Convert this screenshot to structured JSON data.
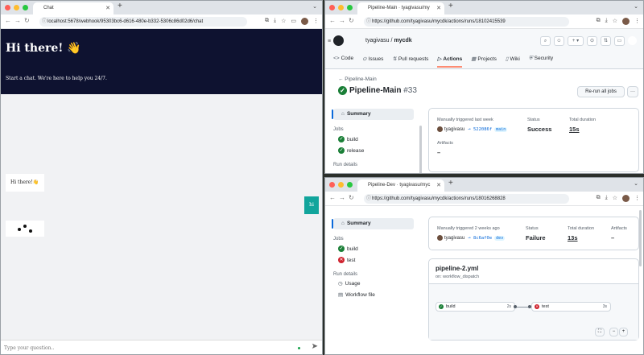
{
  "left_window": {
    "tab_title": "Chat",
    "url": "localhost:5678/webhook/95303bc6-d616-480e-b332-5306c86d02d6/chat",
    "hero_title": "Hi there! 👋",
    "hero_subtitle": "Start a chat. We're here to help you 24/7.",
    "bot_message": "Hi there!👋",
    "user_message": "hi",
    "input_placeholder": "Type your question..",
    "send_icon": "➤"
  },
  "top_right": {
    "tab_title": "Pipeline-Main · tyagivasu/my",
    "url": "https://github.com/tyagivasu/mycdk/actions/runs/18102415539",
    "owner": "tyagivasu",
    "separator": "/",
    "repo": "mycdk",
    "nav": [
      "Code",
      "Issues",
      "Pull requests",
      "Actions",
      "Projects",
      "Wiki",
      "Security"
    ],
    "nav_icons": [
      "<>",
      "⊙",
      "⇅",
      "▷",
      "▦",
      "▯",
      "⛨"
    ],
    "breadcrumb": "← Pipeline-Main",
    "run_name": "Pipeline-Main",
    "run_number": "#33",
    "rerun_label": "Re-run all jobs",
    "more_label": "···",
    "sidebar": {
      "summary": "Summary",
      "jobs_label": "Jobs",
      "jobs": [
        "build",
        "release"
      ],
      "run_details": "Run details"
    },
    "trigger": "Manually triggered last week",
    "actor": "tyagivasu",
    "commit": "522086f",
    "branch": "main",
    "status_label": "Status",
    "status_value": "Success",
    "duration_label": "Total duration",
    "duration_value": "15s",
    "artifacts_label": "Artifacts",
    "artifacts_value": "–"
  },
  "bottom_right": {
    "tab_title": "Pipeline-Dev · tyagivasu/myc",
    "url": "https://github.com/tyagivasu/mycdk/actions/runs/18016268828",
    "sidebar": {
      "summary": "Summary",
      "jobs_label": "Jobs",
      "jobs": [
        "build",
        "test"
      ],
      "run_details": "Run details",
      "details": [
        "Usage",
        "Workflow file"
      ]
    },
    "trigger": "Manually triggered 2 weeks ago",
    "actor": "tyagivasu",
    "commit": "8c6af0e",
    "branch": "dev",
    "status_label": "Status",
    "status_value": "Failure",
    "duration_label": "Total duration",
    "duration_value": "13s",
    "artifacts_label": "Artifacts",
    "artifacts_value": "–",
    "workflow_file": "pipeline-2.yml",
    "workflow_trigger": "on: workflow_dispatch",
    "graph_jobs": [
      {
        "name": "build",
        "time": "2s"
      },
      {
        "name": "test",
        "time": "3s"
      }
    ]
  }
}
